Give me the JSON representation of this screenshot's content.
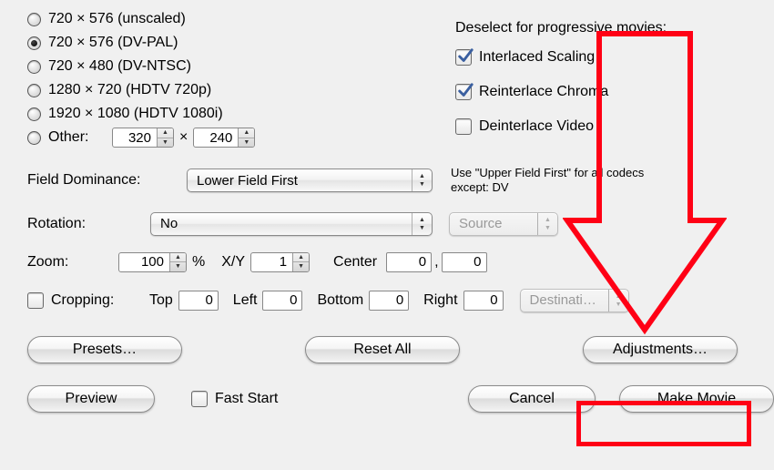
{
  "resolutions": [
    {
      "label": "720 × 576  (unscaled)",
      "selected": false
    },
    {
      "label": "720 × 576  (DV-PAL)",
      "selected": true
    },
    {
      "label": "720 × 480  (DV-NTSC)",
      "selected": false
    },
    {
      "label": "1280 × 720  (HDTV 720p)",
      "selected": false
    },
    {
      "label": "1920 × 1080  (HDTV 1080i)",
      "selected": false
    }
  ],
  "other": {
    "label": "Other:",
    "width": "320",
    "height": "240",
    "separator": "×"
  },
  "deselect_header": "Deselect for progressive movies:",
  "interlace_opts": [
    {
      "key": "interlaced_scaling",
      "label": "Interlaced Scaling",
      "checked": true
    },
    {
      "key": "reinterlace_chroma",
      "label": "Reinterlace Chroma",
      "checked": true
    },
    {
      "key": "deinterlace_video",
      "label": "Deinterlace Video",
      "checked": false
    }
  ],
  "field_dominance": {
    "label": "Field Dominance:",
    "value": "Lower Field First",
    "hint": "Use \"Upper Field First\" for all codecs except: DV"
  },
  "rotation": {
    "label": "Rotation:",
    "value": "No",
    "source_value": "Source",
    "source_enabled": false
  },
  "zoom": {
    "label": "Zoom:",
    "value": "100",
    "percent": "%",
    "xy_label": "X/Y",
    "xy_value": "1",
    "center_label": "Center",
    "center_x": "0",
    "center_y": "0",
    "center_sep": ","
  },
  "cropping": {
    "label": "Cropping:",
    "checked": false,
    "top_label": "Top",
    "top": "0",
    "left_label": "Left",
    "left": "0",
    "bottom_label": "Bottom",
    "bottom": "0",
    "right_label": "Right",
    "right": "0",
    "dest_value": "Destinati…",
    "dest_enabled": false
  },
  "buttons": {
    "presets": "Presets…",
    "reset_all": "Reset All",
    "adjustments": "Adjustments…",
    "preview": "Preview",
    "fast_start_label": "Fast Start",
    "fast_start_checked": false,
    "cancel": "Cancel",
    "make_movie": "Make Movie"
  },
  "annotation": {
    "arrow_color": "#ff0015",
    "highlight_target": "make_movie"
  }
}
